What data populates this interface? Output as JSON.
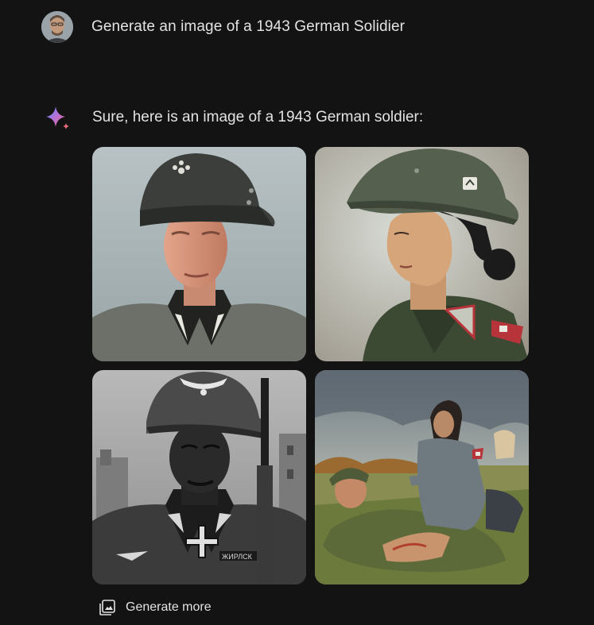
{
  "user_prompt": {
    "text": "Generate an image of a 1943 German Solidier",
    "avatar_icon": "user-avatar"
  },
  "response": {
    "intro_text": "Sure, here is an image of a 1943 German soldier:",
    "assistant_icon": "sparkle-icon",
    "accent_colors": [
      "#4f8ef7",
      "#e86b7a",
      "#b86fd6"
    ]
  },
  "images": [
    {
      "icon": "generated-image-1"
    },
    {
      "icon": "generated-image-2"
    },
    {
      "icon": "generated-image-3"
    },
    {
      "icon": "generated-image-4"
    }
  ],
  "footer": {
    "generate_more_label": "Generate more",
    "generate_more_icon": "image-stack-icon"
  }
}
